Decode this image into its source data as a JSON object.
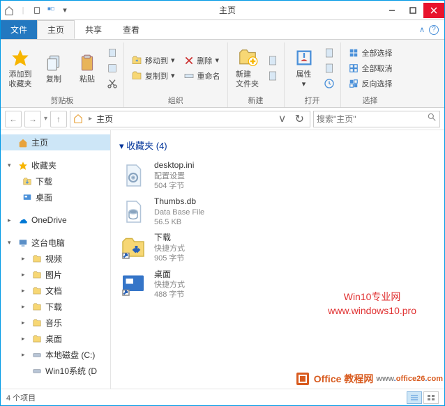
{
  "window": {
    "title": "主页"
  },
  "tabs": {
    "file": "文件",
    "home": "主页",
    "share": "共享",
    "view": "查看"
  },
  "ribbon": {
    "clipboard": {
      "label": "剪贴板",
      "addfav": "添加到\n收藏夹",
      "copy": "复制",
      "paste": "粘贴"
    },
    "organize": {
      "label": "组织",
      "moveto": "移动到",
      "copyto": "复制到",
      "delete": "删除",
      "rename": "重命名"
    },
    "new": {
      "label": "新建",
      "newfolder": "新建\n文件夹"
    },
    "open": {
      "label": "打开",
      "properties": "属性"
    },
    "select": {
      "label": "选择",
      "selectall": "全部选择",
      "selectnone": "全部取消",
      "invert": "反向选择"
    }
  },
  "address": {
    "path": "主页",
    "search_placeholder": "搜索\"主页\""
  },
  "tree": {
    "home": "主页",
    "favorites": "收藏夹",
    "downloads": "下载",
    "desktop": "桌面",
    "onedrive": "OneDrive",
    "thispc": "这台电脑",
    "videos": "视频",
    "pictures": "图片",
    "documents": "文档",
    "downloads2": "下载",
    "music": "音乐",
    "desktop2": "桌面",
    "localdisk": "本地磁盘 (C:)",
    "win10fs": "Win10系统 (D"
  },
  "content": {
    "section": "收藏夹 (4)",
    "items": [
      {
        "name": "desktop.ini",
        "type": "配置设置",
        "size": "504 字节"
      },
      {
        "name": "Thumbs.db",
        "type": "Data Base File",
        "size": "56.5 KB"
      },
      {
        "name": "下载",
        "type": "快捷方式",
        "size": "905 字节"
      },
      {
        "name": "桌面",
        "type": "快捷方式",
        "size": "488 字节"
      }
    ]
  },
  "watermark": {
    "line1": "Win10专业网",
    "line2": "www.windows10.pro"
  },
  "officemark": {
    "text1": "Office",
    "text2": "教程网",
    "dot": ".",
    "domain": "office26",
    "com": "com"
  },
  "status": {
    "count": "4 个项目"
  }
}
